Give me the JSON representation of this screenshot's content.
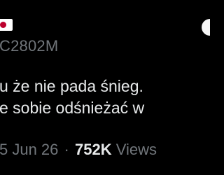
{
  "author": {
    "flag_icon": "japan-flag-icon",
    "handle": "C2802M"
  },
  "post": {
    "lines": [
      "u że nie pada śnieg.",
      "e sobie odśnieżać w"
    ]
  },
  "meta": {
    "date": "5 Jun 26",
    "separator": "·",
    "views_count": "752K",
    "views_label": "Views"
  },
  "colors": {
    "background": "#000000",
    "text": "#e7e9ea",
    "secondary_text": "#71767b",
    "flag_red": "#bc002d"
  }
}
